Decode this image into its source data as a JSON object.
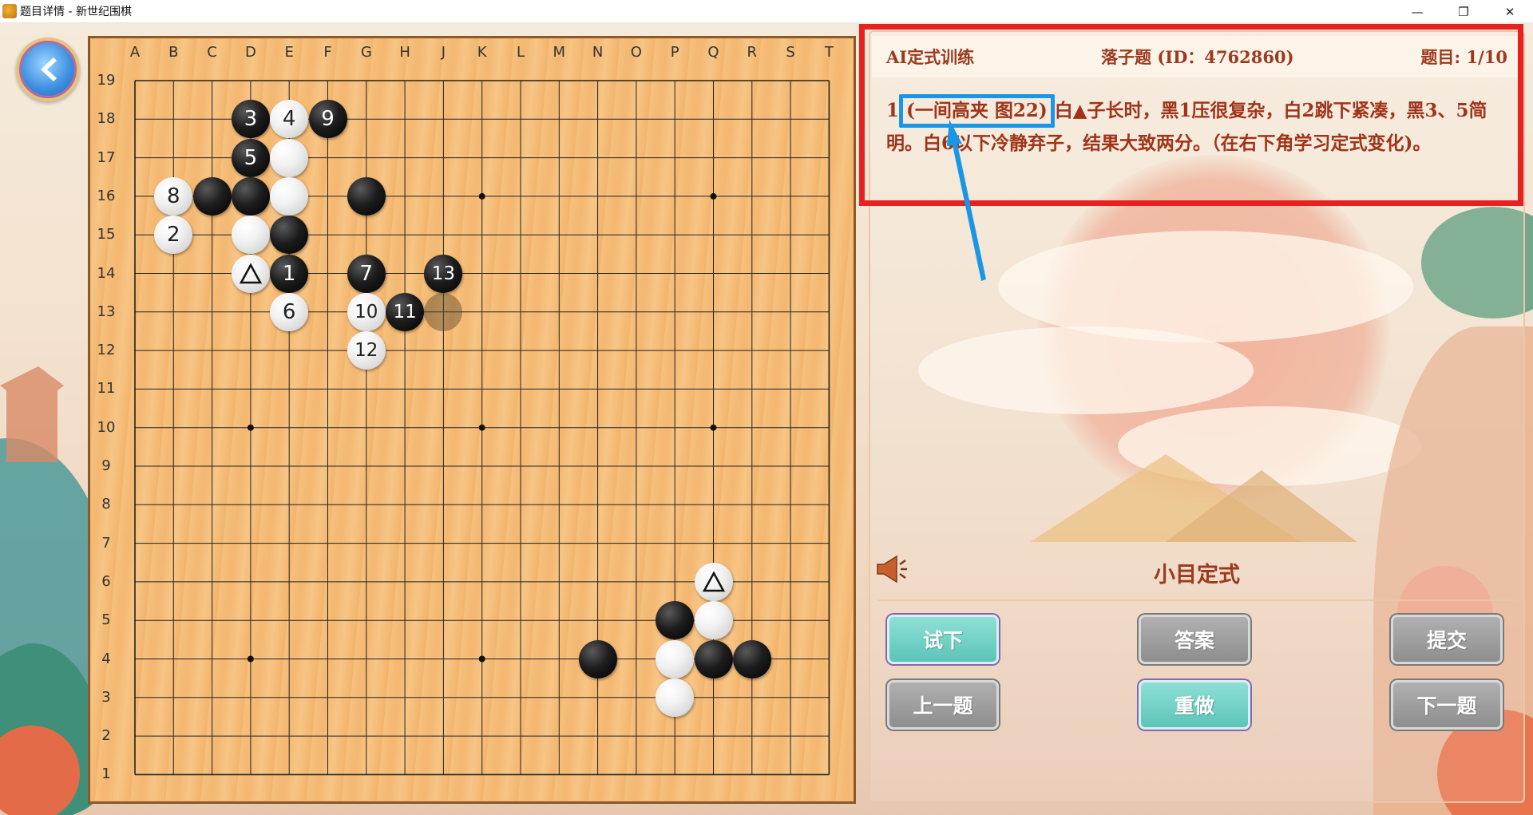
{
  "window": {
    "title": "题目详情 - 新世纪围棋",
    "minimize": "—",
    "restore": "❐",
    "close": "✕"
  },
  "board": {
    "columns": [
      "A",
      "B",
      "C",
      "D",
      "E",
      "F",
      "G",
      "H",
      "J",
      "K",
      "L",
      "M",
      "N",
      "O",
      "P",
      "Q",
      "R",
      "S",
      "T"
    ],
    "rows": [
      "19",
      "18",
      "17",
      "16",
      "15",
      "14",
      "13",
      "12",
      "11",
      "10",
      "9",
      "8",
      "7",
      "6",
      "5",
      "4",
      "3",
      "2",
      "1"
    ],
    "stones": [
      {
        "col": "D",
        "row": 18,
        "color": "black",
        "label": "3"
      },
      {
        "col": "E",
        "row": 18,
        "color": "white",
        "label": "4"
      },
      {
        "col": "F",
        "row": 18,
        "color": "black",
        "label": "9"
      },
      {
        "col": "D",
        "row": 17,
        "color": "black",
        "label": "5"
      },
      {
        "col": "E",
        "row": 17,
        "color": "white",
        "label": ""
      },
      {
        "col": "B",
        "row": 16,
        "color": "white",
        "label": "8"
      },
      {
        "col": "C",
        "row": 16,
        "color": "black",
        "label": ""
      },
      {
        "col": "D",
        "row": 16,
        "color": "black",
        "label": ""
      },
      {
        "col": "E",
        "row": 16,
        "color": "white",
        "label": ""
      },
      {
        "col": "G",
        "row": 16,
        "color": "black",
        "label": ""
      },
      {
        "col": "B",
        "row": 15,
        "color": "white",
        "label": "2"
      },
      {
        "col": "D",
        "row": 15,
        "color": "white",
        "label": ""
      },
      {
        "col": "E",
        "row": 15,
        "color": "black",
        "label": ""
      },
      {
        "col": "D",
        "row": 14,
        "color": "white",
        "label": "△"
      },
      {
        "col": "E",
        "row": 14,
        "color": "black",
        "label": "1"
      },
      {
        "col": "G",
        "row": 14,
        "color": "black",
        "label": "7"
      },
      {
        "col": "J",
        "row": 14,
        "color": "black",
        "label": "13"
      },
      {
        "col": "E",
        "row": 13,
        "color": "white",
        "label": "6"
      },
      {
        "col": "G",
        "row": 13,
        "color": "white",
        "label": "10"
      },
      {
        "col": "H",
        "row": 13,
        "color": "black",
        "label": "11"
      },
      {
        "col": "J",
        "row": 13,
        "color": "ghost",
        "label": ""
      },
      {
        "col": "G",
        "row": 12,
        "color": "white",
        "label": "12"
      },
      {
        "col": "Q",
        "row": 6,
        "color": "white",
        "label": "△"
      },
      {
        "col": "P",
        "row": 5,
        "color": "black",
        "label": ""
      },
      {
        "col": "Q",
        "row": 5,
        "color": "white",
        "label": ""
      },
      {
        "col": "N",
        "row": 4,
        "color": "black",
        "label": ""
      },
      {
        "col": "P",
        "row": 4,
        "color": "white",
        "label": ""
      },
      {
        "col": "Q",
        "row": 4,
        "color": "black",
        "label": ""
      },
      {
        "col": "R",
        "row": 4,
        "color": "black",
        "label": ""
      },
      {
        "col": "P",
        "row": 3,
        "color": "white",
        "label": ""
      }
    ],
    "star_points": [
      "D16",
      "K16",
      "Q16",
      "D10",
      "K10",
      "Q10",
      "D4",
      "K4",
      "Q4"
    ]
  },
  "panel": {
    "category": "AI定式训练",
    "problem_type": "落子题 (ID：4762860)",
    "progress": "题目: 1/10",
    "desc_prefix": "1",
    "desc_highlight": "(一间高夹 图22)",
    "desc_rest": "白▲子长时，黑1压很复杂，白2跳下紧凑，黑3、5简明。白6以下冷静弃子，结果大致两分。（在右下角学习定式变化)。",
    "section_title": "小目定式"
  },
  "buttons": {
    "try": "试下",
    "answer": "答案",
    "submit": "提交",
    "prev": "上一题",
    "redo": "重做",
    "next": "下一题"
  },
  "colors": {
    "annotation_red": "#e8201f",
    "annotation_blue": "#1a96e6",
    "button_teal": "#5cc4b8",
    "button_gray": "#8e8e8e",
    "text_brown": "#9a3b1f"
  },
  "icons": {
    "back": "back-arrow-icon",
    "speaker": "speaker-icon"
  }
}
